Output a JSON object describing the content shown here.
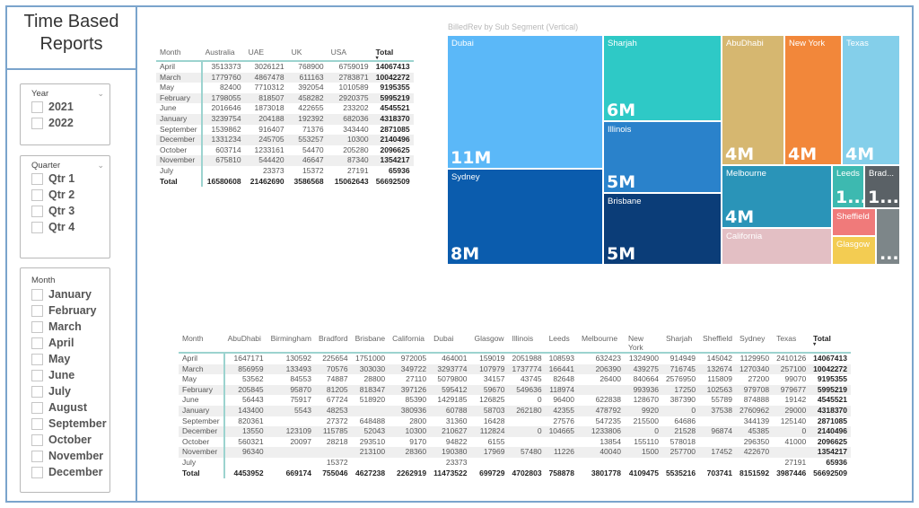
{
  "report": {
    "title_line1": "Time Based",
    "title_line2": "Reports"
  },
  "slicers": {
    "year": {
      "label": "Year",
      "options": [
        "2021",
        "2022"
      ]
    },
    "quarter": {
      "label": "Quarter",
      "options": [
        "Qtr 1",
        "Qtr 2",
        "Qtr 3",
        "Qtr 4"
      ]
    },
    "month": {
      "label": "Month",
      "options": [
        "January",
        "February",
        "March",
        "April",
        "May",
        "June",
        "July",
        "August",
        "September",
        "October",
        "November",
        "December"
      ]
    }
  },
  "country_table": {
    "columns": [
      "Month",
      "Australia",
      "UAE",
      "UK",
      "USA",
      "Total"
    ],
    "rows": [
      [
        "April",
        "3513373",
        "3026121",
        "768900",
        "6759019",
        "14067413"
      ],
      [
        "March",
        "1779760",
        "4867478",
        "611163",
        "2783871",
        "10042272"
      ],
      [
        "May",
        "82400",
        "7710312",
        "392054",
        "1010589",
        "9195355"
      ],
      [
        "February",
        "1798055",
        "818507",
        "458282",
        "2920375",
        "5995219"
      ],
      [
        "June",
        "2016646",
        "1873018",
        "422655",
        "233202",
        "4545521"
      ],
      [
        "January",
        "3239754",
        "204188",
        "192392",
        "682036",
        "4318370"
      ],
      [
        "September",
        "1539862",
        "916407",
        "71376",
        "343440",
        "2871085"
      ],
      [
        "December",
        "1331234",
        "245705",
        "553257",
        "10300",
        "2140496"
      ],
      [
        "October",
        "603714",
        "1233161",
        "54470",
        "205280",
        "2096625"
      ],
      [
        "November",
        "675810",
        "544420",
        "46647",
        "87340",
        "1354217"
      ],
      [
        "July",
        "",
        "23373",
        "15372",
        "27191",
        "65936"
      ]
    ],
    "total_row": [
      "Total",
      "16580608",
      "21462690",
      "3586568",
      "15062643",
      "56692509"
    ]
  },
  "treemap": {
    "title": "BilledRev by Sub Segment (Vertical)",
    "tiles": [
      {
        "name": "Dubai",
        "value": "11M",
        "color": "#5bb8f8"
      },
      {
        "name": "Sydney",
        "value": "8M",
        "color": "#0b5cad"
      },
      {
        "name": "Sharjah",
        "value": "6M",
        "color": "#2ec9c6"
      },
      {
        "name": "Illinois",
        "value": "5M",
        "color": "#2a82cb"
      },
      {
        "name": "Brisbane",
        "value": "5M",
        "color": "#0b3d78"
      },
      {
        "name": "AbuDhabi",
        "value": "4M",
        "color": "#d6b770"
      },
      {
        "name": "New York",
        "value": "4M",
        "color": "#f2873a"
      },
      {
        "name": "Texas",
        "value": "4M",
        "color": "#84cfea"
      },
      {
        "name": "Melbourne",
        "value": "4M",
        "color": "#2a94b8"
      },
      {
        "name": "California",
        "value": "",
        "color": "#e3bfc4"
      },
      {
        "name": "Leeds",
        "value": "1...",
        "color": "#3db9b0"
      },
      {
        "name": "Brad...",
        "value": "1...",
        "color": "#5a6166"
      },
      {
        "name": "Sheffield",
        "value": "",
        "color": "#f07a7a"
      },
      {
        "name": "Glasgow",
        "value": "",
        "color": "#f3cc52"
      },
      {
        "name": "",
        "value": "...",
        "color": "#7d8689"
      }
    ]
  },
  "city_table": {
    "columns": [
      "Month",
      "AbuDhabi",
      "Birmingham",
      "Bradford",
      "Brisbane",
      "California",
      "Dubai",
      "Glasgow",
      "Illinois",
      "Leeds",
      "Melbourne",
      "New York",
      "Sharjah",
      "Sheffield",
      "Sydney",
      "Texas",
      "Total"
    ],
    "rows": [
      [
        "April",
        "1647171",
        "130592",
        "225654",
        "1751000",
        "972005",
        "464001",
        "159019",
        "2051988",
        "108593",
        "632423",
        "1324900",
        "914949",
        "145042",
        "1129950",
        "2410126",
        "14067413"
      ],
      [
        "March",
        "856959",
        "133493",
        "70576",
        "303030",
        "349722",
        "3293774",
        "107979",
        "1737774",
        "166441",
        "206390",
        "439275",
        "716745",
        "132674",
        "1270340",
        "257100",
        "10042272"
      ],
      [
        "May",
        "53562",
        "84553",
        "74887",
        "28800",
        "27110",
        "5079800",
        "34157",
        "43745",
        "82648",
        "26400",
        "840664",
        "2576950",
        "115809",
        "27200",
        "99070",
        "9195355"
      ],
      [
        "February",
        "205845",
        "95870",
        "81205",
        "818347",
        "397126",
        "595412",
        "59670",
        "549636",
        "118974",
        "",
        "993936",
        "17250",
        "102563",
        "979708",
        "979677",
        "5995219"
      ],
      [
        "June",
        "56443",
        "75917",
        "67724",
        "518920",
        "85390",
        "1429185",
        "126825",
        "0",
        "96400",
        "622838",
        "128670",
        "387390",
        "55789",
        "874888",
        "19142",
        "4545521"
      ],
      [
        "January",
        "143400",
        "5543",
        "48253",
        "",
        "380936",
        "60788",
        "58703",
        "262180",
        "42355",
        "478792",
        "9920",
        "0",
        "37538",
        "2760962",
        "29000",
        "4318370"
      ],
      [
        "September",
        "820361",
        "",
        "27372",
        "648488",
        "2800",
        "31360",
        "16428",
        "",
        "27576",
        "547235",
        "215500",
        "64686",
        "",
        "344139",
        "125140",
        "2871085"
      ],
      [
        "December",
        "13550",
        "123109",
        "115785",
        "52043",
        "10300",
        "210627",
        "112824",
        "0",
        "104665",
        "1233806",
        "0",
        "21528",
        "96874",
        "45385",
        "0",
        "2140496"
      ],
      [
        "October",
        "560321",
        "20097",
        "28218",
        "293510",
        "9170",
        "94822",
        "6155",
        "",
        "",
        "13854",
        "155110",
        "578018",
        "",
        "296350",
        "41000",
        "2096625"
      ],
      [
        "November",
        "96340",
        "",
        "",
        "213100",
        "28360",
        "190380",
        "17969",
        "57480",
        "11226",
        "40040",
        "1500",
        "257700",
        "17452",
        "422670",
        "",
        "1354217"
      ],
      [
        "July",
        "",
        "",
        "15372",
        "",
        "",
        "23373",
        "",
        "",
        "",
        "",
        "",
        "",
        "",
        "",
        "27191",
        "65936"
      ]
    ],
    "total_row": [
      "Total",
      "4453952",
      "669174",
      "755046",
      "4627238",
      "2262919",
      "11473522",
      "699729",
      "4702803",
      "758878",
      "3801778",
      "4109475",
      "5535216",
      "703741",
      "8151592",
      "3987446",
      "56692509"
    ]
  },
  "icons": {
    "chevron": "chevron-down-icon",
    "sort": "sort-descending-icon"
  }
}
